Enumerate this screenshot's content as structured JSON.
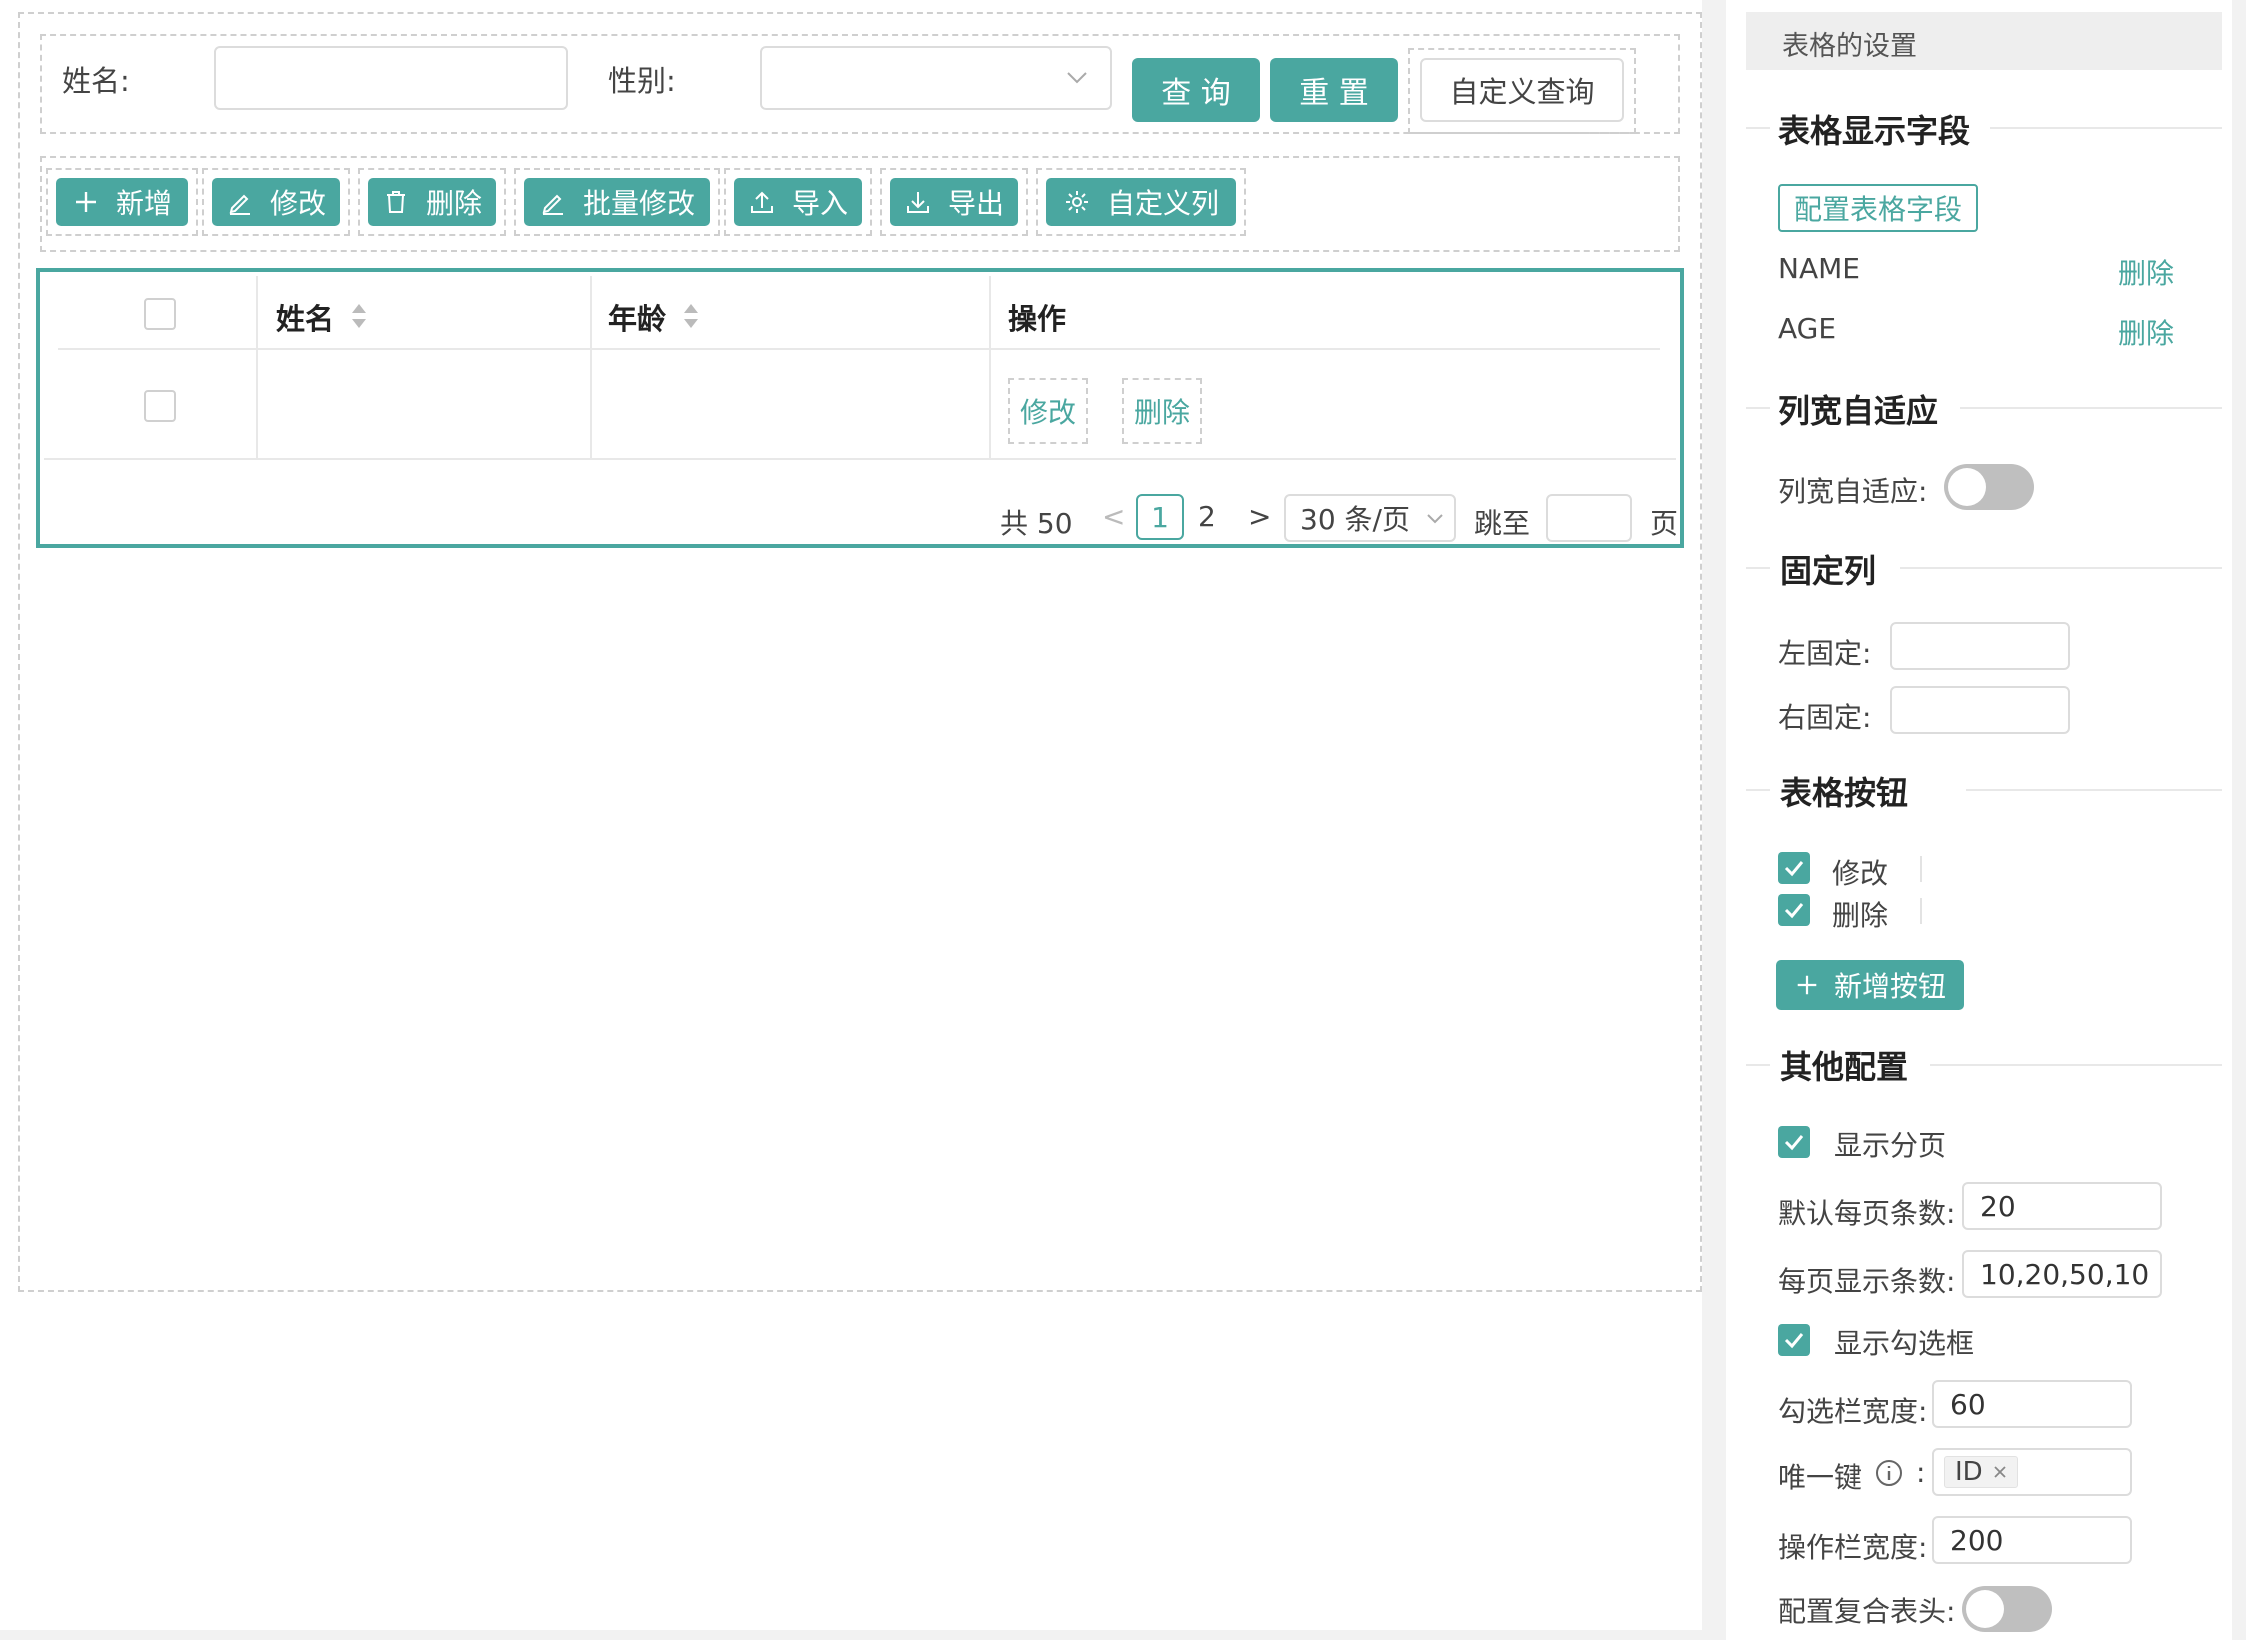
{
  "search": {
    "name_label": "姓名:",
    "gender_label": "性别:",
    "query_btn": "查 询",
    "reset_btn": "重 置",
    "custom_query_btn": "自定义查询"
  },
  "toolbar": {
    "add": "新增",
    "edit": "修改",
    "delete": "删除",
    "batch_edit": "批量修改",
    "import": "导入",
    "export": "导出",
    "custom_columns": "自定义列"
  },
  "table": {
    "headers": [
      "姓名",
      "年龄",
      "操作"
    ],
    "row_actions": {
      "edit": "修改",
      "delete": "删除"
    }
  },
  "pagination": {
    "total": "共 50",
    "pages": [
      "1",
      "2"
    ],
    "current": "1",
    "page_size": "30 条/页",
    "jump_label": "跳至",
    "page_suffix": "页"
  },
  "settings": {
    "panel_title": "表格的设置",
    "display_fields": {
      "title": "表格显示字段",
      "config_btn": "配置表格字段",
      "fields": [
        {
          "name": "NAME",
          "action": "删除"
        },
        {
          "name": "AGE",
          "action": "删除"
        }
      ]
    },
    "auto_width": {
      "title": "列宽自适应",
      "label": "列宽自适应:"
    },
    "fixed": {
      "title": "固定列",
      "left_label": "左固定:",
      "right_label": "右固定:"
    },
    "buttons": {
      "title": "表格按钮",
      "items": [
        "修改",
        "删除"
      ],
      "add_btn": "新增按钮"
    },
    "other": {
      "title": "其他配置",
      "show_pagination": "显示分页",
      "default_page_size_label": "默认每页条数:",
      "default_page_size": "20",
      "page_sizes_label": "每页显示条数:",
      "page_sizes": "10,20,50,10",
      "show_checkbox": "显示勾选框",
      "checkbox_width_label": "勾选栏宽度:",
      "checkbox_width": "60",
      "unique_key_label": "唯一键",
      "unique_key_sep": ":",
      "unique_key_tag": "ID",
      "action_width_label": "操作栏宽度:",
      "action_width": "200",
      "compound_header_label": "配置复合表头:"
    }
  },
  "colors": {
    "accent": "#4aa7a0"
  }
}
